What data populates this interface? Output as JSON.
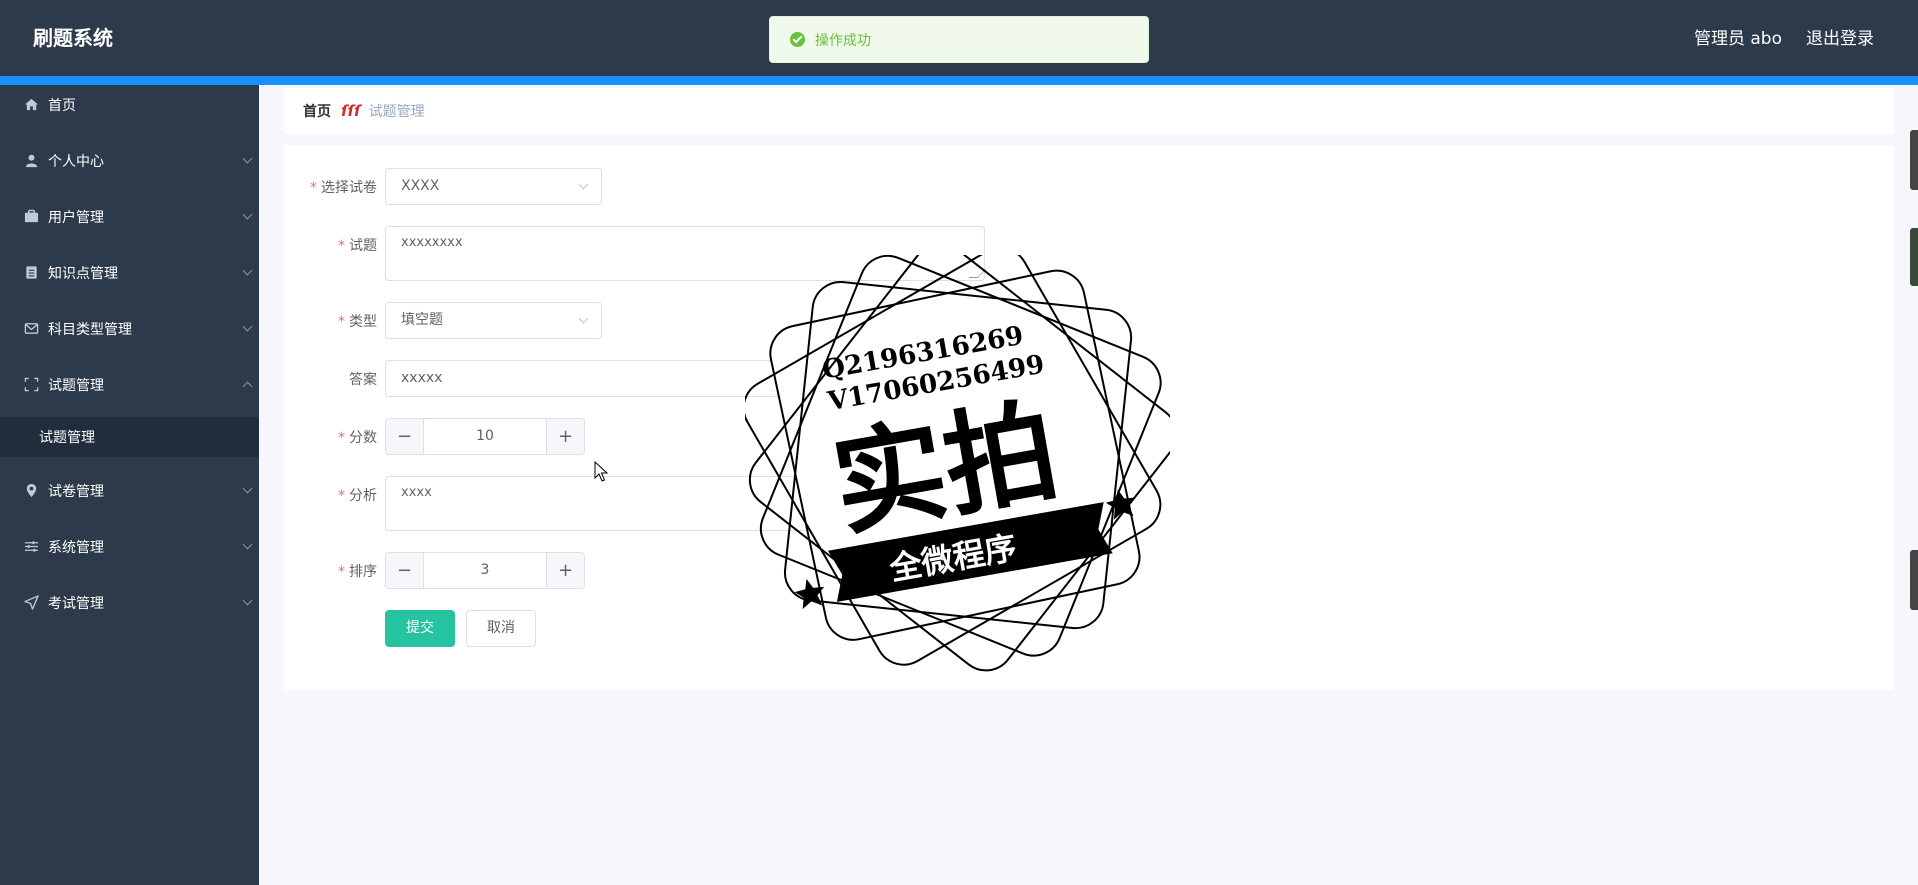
{
  "header": {
    "app_title": "刷题系统",
    "user_label": "管理员 abo",
    "logout_label": "退出登录"
  },
  "toast": {
    "message": "操作成功",
    "color": "#67c23a"
  },
  "sidebar": {
    "items": [
      {
        "label": "首页",
        "icon": "home-icon",
        "expandable": false
      },
      {
        "label": "个人中心",
        "icon": "user-icon",
        "expandable": true
      },
      {
        "label": "用户管理",
        "icon": "briefcase-icon",
        "expandable": true
      },
      {
        "label": "知识点管理",
        "icon": "document-icon",
        "expandable": true
      },
      {
        "label": "科目类型管理",
        "icon": "mail-icon",
        "expandable": true
      },
      {
        "label": "试题管理",
        "icon": "fullscreen-icon",
        "expandable": true,
        "expanded": true
      },
      {
        "label": "试卷管理",
        "icon": "location-icon",
        "expandable": true
      },
      {
        "label": "系统管理",
        "icon": "sliders-icon",
        "expandable": true
      },
      {
        "label": "考试管理",
        "icon": "send-icon",
        "expandable": true
      }
    ],
    "sub_items": [
      {
        "label": "试题管理"
      }
    ]
  },
  "breadcrumb": {
    "home": "首页",
    "current": "试题管理"
  },
  "form": {
    "paper": {
      "label": "选择试卷",
      "value": "XXXX"
    },
    "question": {
      "label": "试题",
      "value": "xxxxxxxx"
    },
    "type": {
      "label": "类型",
      "value": "填空题"
    },
    "answer": {
      "label": "答案",
      "value": "xxxxx"
    },
    "score": {
      "label": "分数",
      "value": "10"
    },
    "analysis": {
      "label": "分析",
      "value": "xxxx"
    },
    "order": {
      "label": "排序",
      "value": "3"
    },
    "submit_label": "提交",
    "cancel_label": "取消"
  },
  "watermark": {
    "line1": "Q2196316269",
    "line2": "V17060256499",
    "big_text": "实拍",
    "banner_text": "全微程序"
  },
  "colors": {
    "header_bg": "#2d3a4b",
    "accent_bar": "#1890ff",
    "primary_button": "#26c3a0",
    "required": "#f56c6c"
  }
}
